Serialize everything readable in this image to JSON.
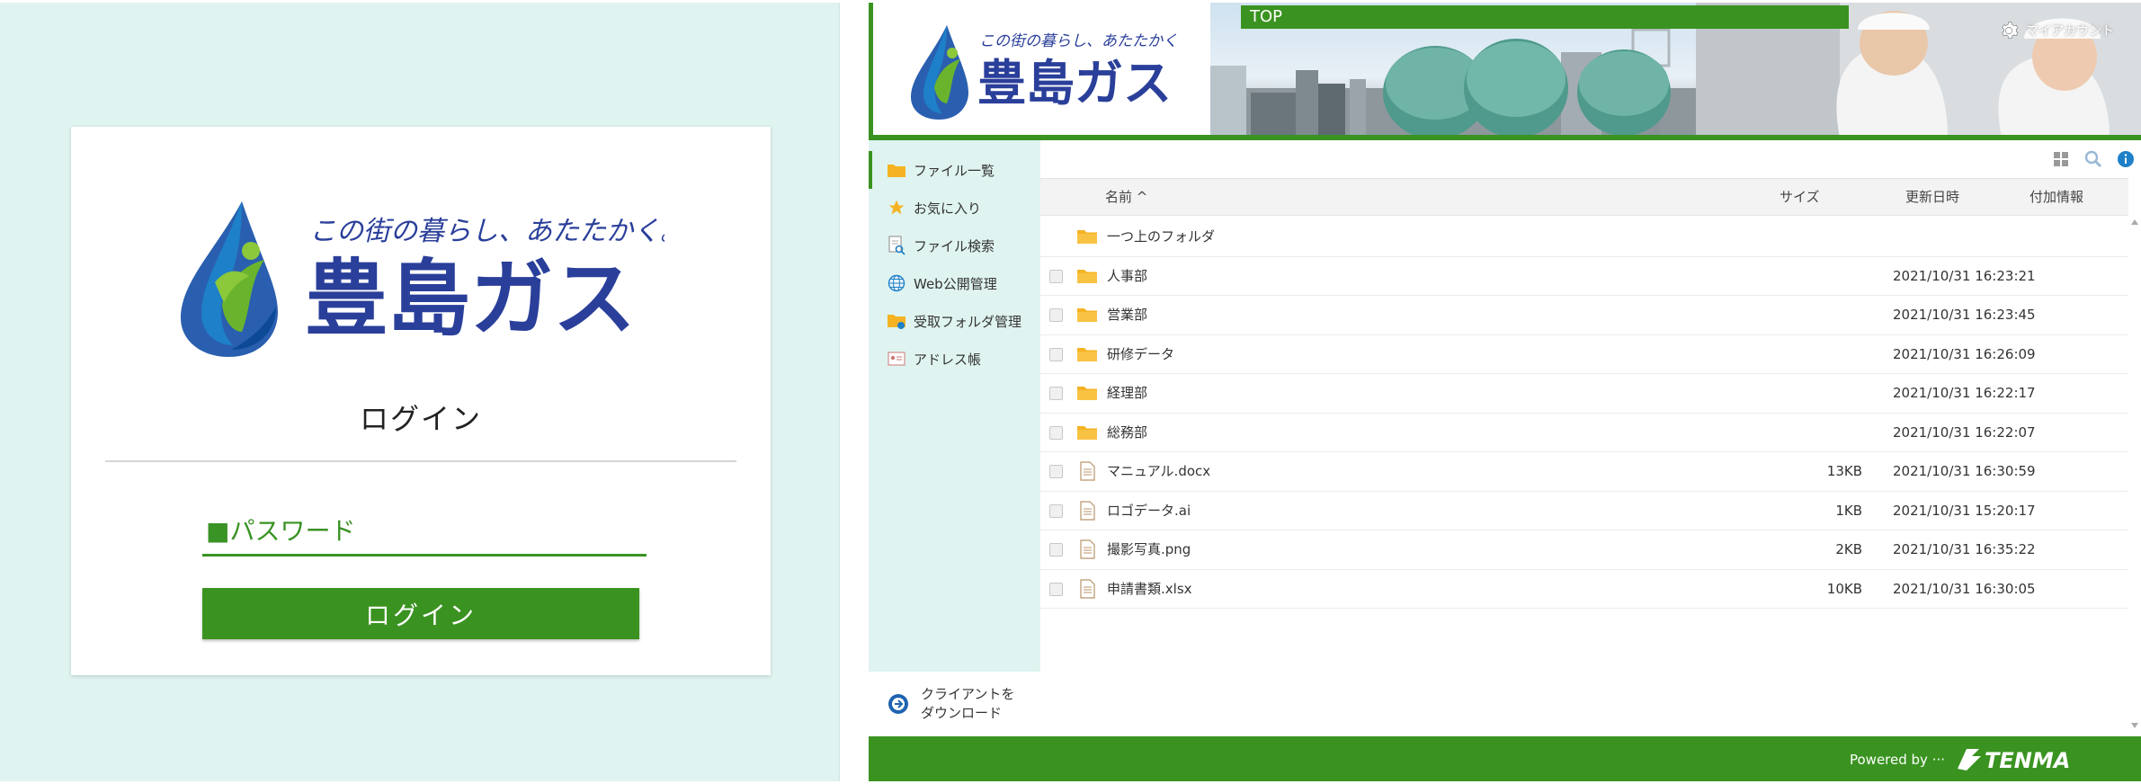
{
  "login": {
    "logo_tagline": "この街の暮らし、あたたかく。",
    "logo_name": "豊島ガス",
    "title": "ログイン",
    "password_placeholder": "■パスワード",
    "button_label": "ログイン"
  },
  "header": {
    "logo_tagline": "この街の暮らし、あたたかく。",
    "logo_name": "豊島ガス",
    "top_label": "TOP",
    "account_label": "マイアカウント"
  },
  "sidebar": {
    "items": [
      {
        "label": "ファイル一覧",
        "icon": "folder-icon"
      },
      {
        "label": "お気に入り",
        "icon": "star-icon"
      },
      {
        "label": "ファイル検索",
        "icon": "file-search-icon"
      },
      {
        "label": "Web公開管理",
        "icon": "globe-icon"
      },
      {
        "label": "受取フォルダ管理",
        "icon": "inbox-folder-icon"
      },
      {
        "label": "アドレス帳",
        "icon": "address-book-icon"
      }
    ],
    "client_download": "クライアントを\nダウンロード"
  },
  "table": {
    "columns": {
      "name": "名前 ^",
      "size": "サイズ",
      "date": "更新日時",
      "extra": "付加情報"
    },
    "rows": [
      {
        "type": "folder",
        "name": "一つ上のフォルダ",
        "size": "",
        "date": "",
        "checkbox": false
      },
      {
        "type": "folder",
        "name": "人事部",
        "size": "",
        "date": "2021/10/31 16:23:21",
        "checkbox": true
      },
      {
        "type": "folder",
        "name": "営業部",
        "size": "",
        "date": "2021/10/31 16:23:45",
        "checkbox": true
      },
      {
        "type": "folder",
        "name": "研修データ",
        "size": "",
        "date": "2021/10/31 16:26:09",
        "checkbox": true
      },
      {
        "type": "folder",
        "name": "経理部",
        "size": "",
        "date": "2021/10/31 16:22:17",
        "checkbox": true
      },
      {
        "type": "folder",
        "name": "総務部",
        "size": "",
        "date": "2021/10/31 16:22:07",
        "checkbox": true
      },
      {
        "type": "file",
        "name": "マニュアル.docx",
        "size": "13KB",
        "date": "2021/10/31 16:30:59",
        "checkbox": true
      },
      {
        "type": "file",
        "name": "ロゴデータ.ai",
        "size": "1KB",
        "date": "2021/10/31 15:20:17",
        "checkbox": true
      },
      {
        "type": "file",
        "name": "撮影写真.png",
        "size": "2KB",
        "date": "2021/10/31 16:35:22",
        "checkbox": true
      },
      {
        "type": "file",
        "name": "申請書類.xlsx",
        "size": "10KB",
        "date": "2021/10/31 16:30:05",
        "checkbox": true
      }
    ]
  },
  "footer": {
    "powered_by": "Powered by ···",
    "brand": "TENMA"
  },
  "colors": {
    "accent_green": "#3a9320",
    "panel_mint": "#dff4f0",
    "logo_blue": "#2a3f9a",
    "folder_yellow": "#f5b324"
  }
}
